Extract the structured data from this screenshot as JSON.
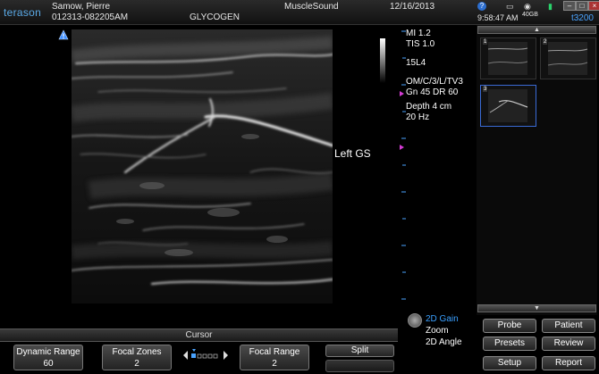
{
  "header": {
    "logo": "terason",
    "patient_name": "Samow, Pierre",
    "patient_id": "012313-082205AM",
    "exam_type": "GLYCOGEN",
    "institution": "MuscleSound",
    "date": "12/16/2013",
    "time": "9:58:47 AM",
    "storage": "40GB",
    "probe_model": "t3200",
    "help_icon": "help-icon",
    "accent_color": "#4aa3ff"
  },
  "image_params": {
    "mi": "MI  1.2",
    "tis": "TIS 1.0",
    "probe": "15L4",
    "preset": "OM/C/3/L/TV3",
    "gain_dr": "Gn 45   DR 60",
    "depth": "Depth 4 cm",
    "frame_rate": "20 Hz"
  },
  "annotation": "Left GS",
  "thumbnails": [
    {
      "label": "1"
    },
    {
      "label": "2"
    },
    {
      "label": "3"
    }
  ],
  "toolbar": {
    "cursor_label": "Cursor",
    "dynamic_range_label": "Dynamic Range",
    "dynamic_range_value": "60",
    "focal_zones_label": "Focal Zones",
    "focal_zones_value": "2",
    "focal_range_label": "Focal Range",
    "focal_range_value": "2",
    "split_label": "Split"
  },
  "gain_menu": {
    "active": "2D Gain",
    "zoom": "Zoom",
    "angle": "2D Angle",
    "active_color": "#3aa0ff"
  },
  "right_buttons": {
    "probe": "Probe",
    "patient": "Patient",
    "presets": "Presets",
    "review": "Review",
    "setup": "Setup",
    "report": "Report"
  }
}
